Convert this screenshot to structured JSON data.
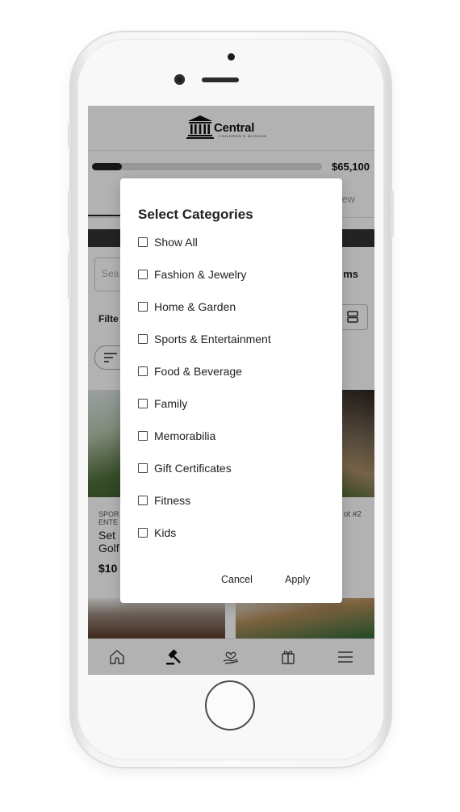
{
  "app": {
    "progress_amount": "$65,100",
    "progress_fraction": 0.13,
    "tab_right_partial": "ew",
    "search_placeholder_partial": "Sea",
    "items_partial": "ms",
    "filter_partial": "Filte"
  },
  "logo": {
    "name": "Central",
    "subtitle": "CHILDREN'S MUSEUM",
    "icon": "museum-building-icon"
  },
  "cards": {
    "left": {
      "category_lines": [
        "SPOR",
        "ENTE"
      ],
      "title_lines": [
        "Set",
        "Golf"
      ],
      "price_partial": "$10"
    },
    "right": {
      "lot_partial": "ot #2"
    }
  },
  "bottom_nav": {
    "icons": [
      "home-icon",
      "gavel-icon",
      "donate-heart-hand-icon",
      "gift-icon",
      "menu-icon"
    ]
  },
  "modal": {
    "title": "Select Categories",
    "options": [
      {
        "label": "Show All",
        "checked": false
      },
      {
        "label": "Fashion & Jewelry",
        "checked": false
      },
      {
        "label": "Home & Garden",
        "checked": false
      },
      {
        "label": "Sports & Entertainment",
        "checked": false
      },
      {
        "label": "Food & Beverage",
        "checked": false
      },
      {
        "label": "Family",
        "checked": false
      },
      {
        "label": "Memorabilia",
        "checked": false
      },
      {
        "label": "Gift Certificates",
        "checked": false
      },
      {
        "label": "Fitness",
        "checked": false
      },
      {
        "label": "Kids",
        "checked": false
      }
    ],
    "cancel_label": "Cancel",
    "apply_label": "Apply"
  },
  "colors": {
    "overlay": "#000000",
    "modal_bg": "#ffffff",
    "text_primary": "#222222",
    "progress_fill": "#222222",
    "progress_track": "#d8d8d8"
  }
}
